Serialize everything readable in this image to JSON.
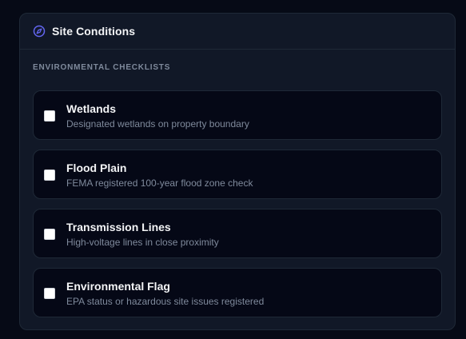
{
  "panel": {
    "title": "Site Conditions",
    "icon": "compass-icon",
    "accent_color": "#6366f1"
  },
  "section": {
    "label": "ENVIRONMENTAL CHECKLISTS"
  },
  "checklist": [
    {
      "title": "Wetlands",
      "description": "Designated wetlands on property boundary",
      "checked": false
    },
    {
      "title": "Flood Plain",
      "description": "FEMA registered 100-year flood zone check",
      "checked": false
    },
    {
      "title": "Transmission Lines",
      "description": "High-voltage lines in close proximity",
      "checked": false
    },
    {
      "title": "Environmental Flag",
      "description": "EPA status or hazardous site issues registered",
      "checked": false
    }
  ]
}
